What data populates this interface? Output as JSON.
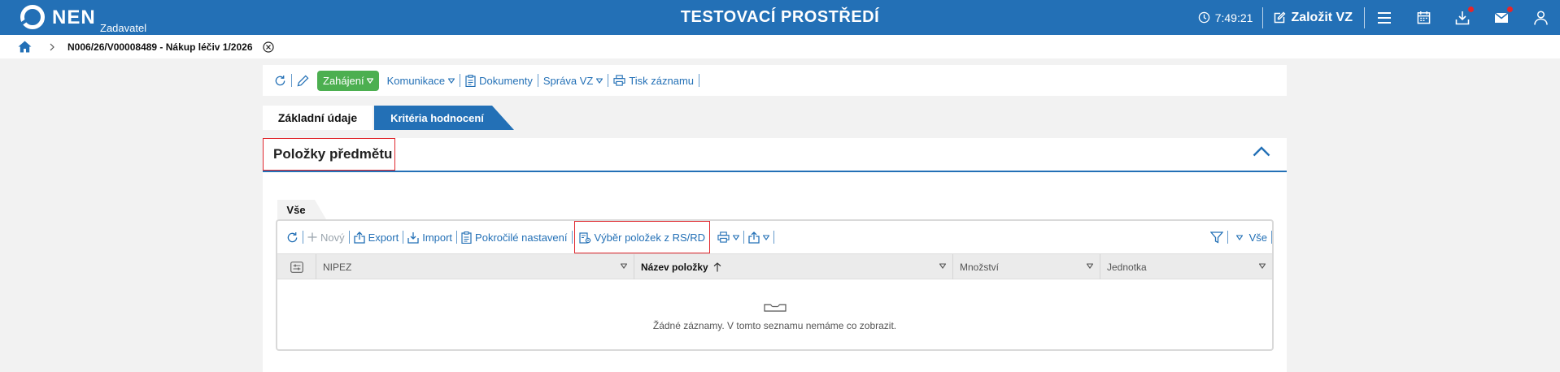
{
  "header": {
    "logo_text": "NEN",
    "logo_sub": "Zadavatel",
    "env_title": "TESTOVACÍ PROSTŘEDÍ",
    "clock": "7:49:21",
    "create_vz": "Založit VZ",
    "icons": [
      "clock-icon",
      "edit-icon",
      "menu-icon",
      "calendar-icon",
      "download-icon",
      "mail-icon",
      "user-icon"
    ]
  },
  "breadcrumb": {
    "current": "N006/26/V00008489 - Nákup léčiv 1/2026"
  },
  "toolbar": {
    "start_label": "Zahájení",
    "communication_label": "Komunikace",
    "documents_label": "Dokumenty",
    "manage_label": "Správa VZ",
    "print_label": "Tisk záznamu"
  },
  "tabs": [
    {
      "label": "Základní údaje",
      "active": true
    },
    {
      "label": "Kritéria hodnocení",
      "active": false
    }
  ],
  "section": {
    "title": "Položky předmětu",
    "subtab": "Vše",
    "grid_toolbar": {
      "new_label": "Nový",
      "export_label": "Export",
      "import_label": "Import",
      "advanced_label": "Pokročilé nastavení",
      "select_items_label": "Výběr položek z RS/RD",
      "filter_all_label": "Vše"
    },
    "columns": [
      "NIPEZ",
      "Název položky",
      "Množství",
      "Jednotka"
    ],
    "empty_text": "Žádné záznamy. V tomto seznamu nemáme co zobrazit."
  },
  "colors": {
    "primary": "#2370b6",
    "green": "#4caf50",
    "highlight": "#e0272d",
    "notification": "#e6252a"
  }
}
